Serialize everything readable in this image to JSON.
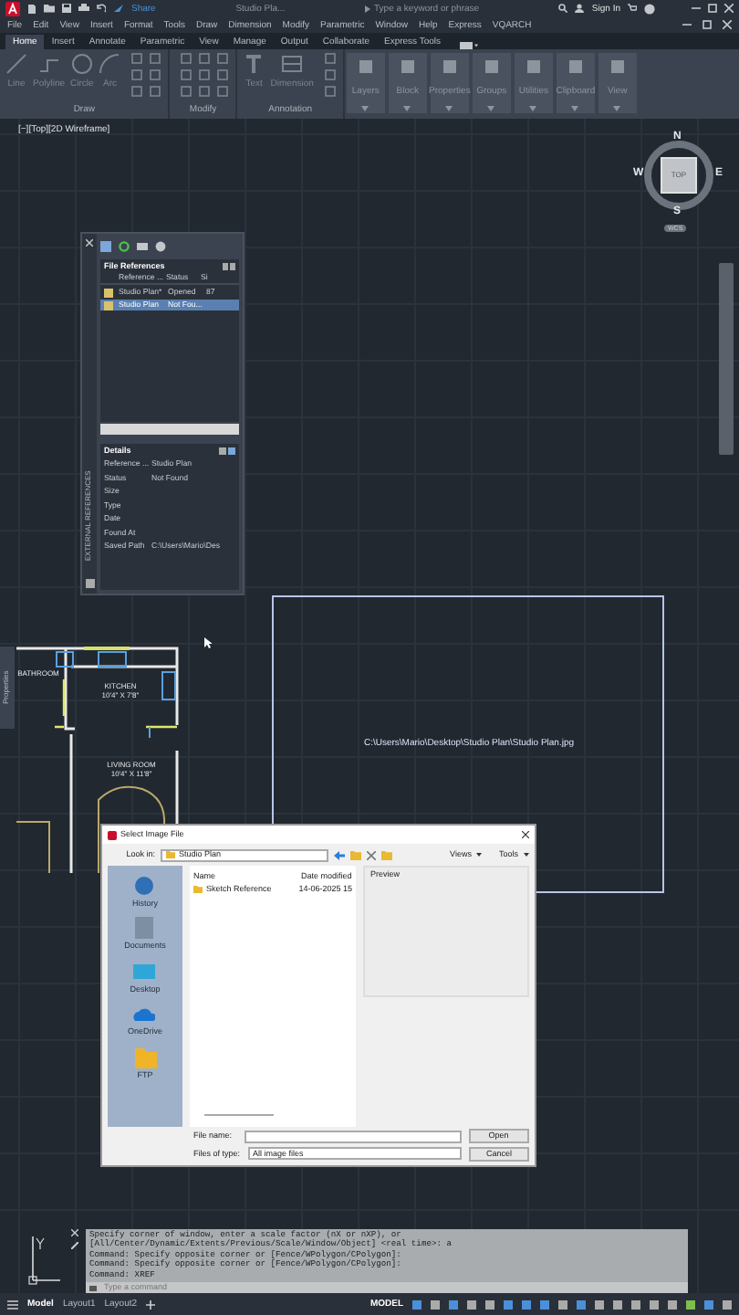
{
  "title_bar": {
    "share": "Share",
    "document": "Studio Pla...",
    "search_placeholder": "Type a keyword or phrase",
    "sign_in": "Sign In"
  },
  "menu_bar": [
    "File",
    "Edit",
    "View",
    "Insert",
    "Format",
    "Tools",
    "Draw",
    "Dimension",
    "Modify",
    "Parametric",
    "Window",
    "Help",
    "Express",
    "VQARCH"
  ],
  "ribbon_tabs": [
    {
      "label": "Home",
      "selected": true
    },
    {
      "label": "Insert",
      "selected": false
    },
    {
      "label": "Annotate",
      "selected": false
    },
    {
      "label": "Parametric",
      "selected": false
    },
    {
      "label": "View",
      "selected": false
    },
    {
      "label": "Manage",
      "selected": false
    },
    {
      "label": "Output",
      "selected": false
    },
    {
      "label": "Collaborate",
      "selected": false
    },
    {
      "label": "Express Tools",
      "selected": false
    }
  ],
  "ribbon_panels": [
    {
      "title": "Draw",
      "tools": [
        "Line",
        "Polyline",
        "Circle",
        "Arc"
      ]
    },
    {
      "title": "Modify"
    },
    {
      "title": "Annotation",
      "tools": [
        "Text",
        "Dimension"
      ]
    }
  ],
  "ribbon_groups": [
    "Layers",
    "Block",
    "Properties",
    "Groups",
    "Utilities",
    "Clipboard",
    "View"
  ],
  "viewport_label": "[−][Top][2D Wireframe]",
  "view_cube": {
    "north": "N",
    "south": "S",
    "east": "E",
    "west": "W",
    "face": "TOP",
    "ucs": "WCS"
  },
  "xref_palette": {
    "side_title": "EXTERNAL REFERENCES",
    "section": "File References",
    "columns": [
      "Reference ...",
      "Status",
      "Si"
    ],
    "rows": [
      {
        "name": "Studio Plan*",
        "status": "Opened",
        "size": "87",
        "selected": false
      },
      {
        "name": "Studio Plan",
        "status": "Not Fou...",
        "selected": true
      }
    ],
    "details_title": "Details",
    "details": [
      {
        "label": "Reference ...",
        "value": "Studio Plan"
      },
      {
        "label": "Status",
        "value": "Not Found"
      },
      {
        "label": "Size"
      },
      {
        "label": "Type"
      },
      {
        "label": "Date"
      },
      {
        "label": "Found At"
      },
      {
        "label": "Saved Path",
        "value": "C:\\Users\\Mario\\Des"
      }
    ]
  },
  "properties_tab": "Properties",
  "floor_plan": {
    "rooms": [
      {
        "name": "BATHROOM"
      },
      {
        "name": "KITCHEN",
        "size": "10'4\" X 7'8\""
      },
      {
        "name": "LIVING ROOM",
        "size": "10'4\" X 11'8\""
      }
    ]
  },
  "image_frame": {
    "path": "C:\\Users\\Mario\\Desktop\\Studio Plan\\Studio Plan.jpg"
  },
  "dialog": {
    "title": "Select Image File",
    "look_in_label": "Look in:",
    "look_in": "Studio Plan",
    "views": "Views",
    "tools": "Tools",
    "places": [
      "History",
      "Documents",
      "Desktop",
      "OneDrive",
      "FTP"
    ],
    "columns": [
      "Name",
      "Date modified"
    ],
    "files": [
      {
        "name": "Sketch Reference",
        "date": "14-06-2025 15"
      }
    ],
    "preview_label": "Preview",
    "file_name_label": "File name:",
    "open": "Open",
    "file_type_label": "Files of type:",
    "file_type": "All image files",
    "cancel": "Cancel"
  },
  "command_history": [
    "Specify corner of window, enter a scale factor (nX or nXP), or",
    "[All/Center/Dynamic/Extents/Previous/Scale/Window/Object] <real time>: a",
    "Command: Specify opposite corner or [Fence/WPolygon/CPolygon]:",
    "Command: Specify opposite corner or [Fence/WPolygon/CPolygon]:",
    "Command: XREF"
  ],
  "command_placeholder": "Type a command",
  "layout_tabs": [
    {
      "label": "Model",
      "selected": true
    },
    {
      "label": "Layout1",
      "selected": false
    },
    {
      "label": "Layout2",
      "selected": false
    }
  ],
  "status_mode": "MODEL"
}
